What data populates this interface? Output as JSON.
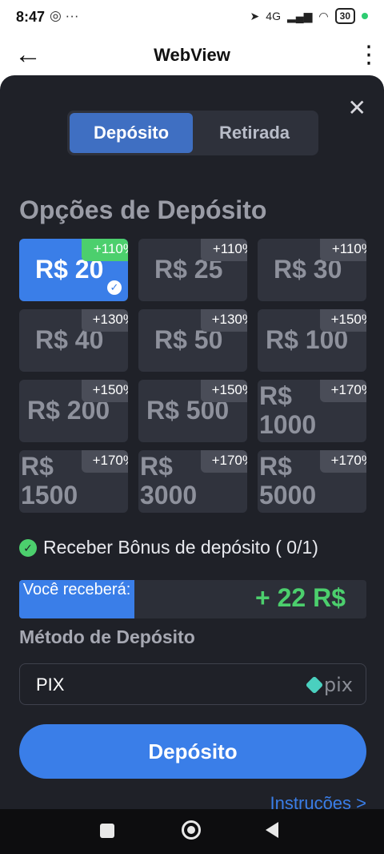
{
  "status_bar": {
    "time": "8:47",
    "left_icons": "◎ ···",
    "network": "4G",
    "battery": "30"
  },
  "app_bar": {
    "title": "WebView",
    "back_icon": "arrow-left",
    "menu_icon": "more-vertical"
  },
  "modal": {
    "close_icon": "close",
    "tabs": [
      {
        "label": "Depósito",
        "active": true
      },
      {
        "label": "Retirada",
        "active": false
      }
    ],
    "options_title": "Opções de Depósito",
    "options": [
      {
        "amount": "R$ 20",
        "bonus": "+110%",
        "selected": true
      },
      {
        "amount": "R$ 25",
        "bonus": "+110%",
        "selected": false
      },
      {
        "amount": "R$ 30",
        "bonus": "+110%",
        "selected": false
      },
      {
        "amount": "R$ 40",
        "bonus": "+130%",
        "selected": false
      },
      {
        "amount": "R$ 50",
        "bonus": "+130%",
        "selected": false
      },
      {
        "amount": "R$ 100",
        "bonus": "+150%",
        "selected": false
      },
      {
        "amount": "R$ 200",
        "bonus": "+150%",
        "selected": false
      },
      {
        "amount": "R$ 500",
        "bonus": "+150%",
        "selected": false
      },
      {
        "amount": "R$ 1000",
        "bonus": "+170%",
        "selected": false
      },
      {
        "amount": "R$ 1500",
        "bonus": "+170%",
        "selected": false
      },
      {
        "amount": "R$ 3000",
        "bonus": "+170%",
        "selected": false
      },
      {
        "amount": "R$ 5000",
        "bonus": "+170%",
        "selected": false
      }
    ],
    "bonus_label": "Receber Bônus de depósito ( 0/1)",
    "receive_label": "Você receberá:",
    "receive_value": "+ 22 R$",
    "method_title": "Método de Depósito",
    "method_value": "PIX",
    "method_logo_text": "pix",
    "deposit_button": "Depósito",
    "instructions_link": "Instruções >"
  },
  "colors": {
    "panel_bg": "#1f2128",
    "accent_blue": "#3a7ee8",
    "bonus_green": "#4ccf6d"
  }
}
